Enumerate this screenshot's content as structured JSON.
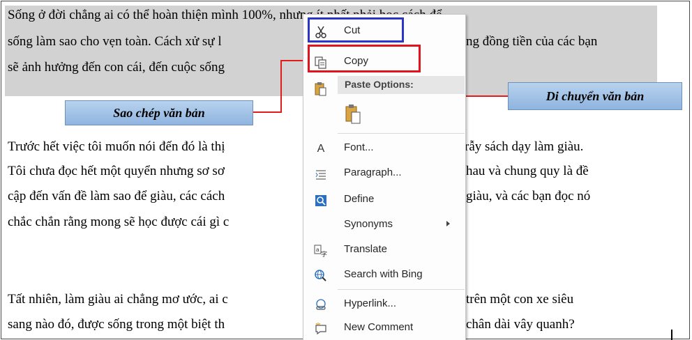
{
  "document": {
    "lines": [
      "Sống ở đời chẳng ai có thể hoàn thiện mình 100%, nhưng ít nhất phải học cách để",
      "sống làm sao cho vẹn toàn. Cách xử sự l",
      "ng đồng tiền của các bạn",
      "sẽ ảnh hưởng đến con cái, đến cuộc sống",
      "Trước hết việc tôi muốn nói đến đó là thị",
      "rẫy sách dạy làm giàu.",
      "Tôi chưa đọc hết một quyển nhưng sơ sơ",
      "hau và chung quy là đề",
      "cập đến vấn đề làm sao để giàu, các cách",
      "giàu, và các bạn đọc nó",
      "chắc chắn rằng mong sẽ học được cái gì c",
      "Tất nhiên, làm giàu ai chẳng mơ ước, ai c",
      "trên một con xe siêu",
      "sang nào đó, được sống trong một biệt th",
      "chân dài vây quanh?"
    ]
  },
  "callouts": {
    "copy": "Sao chép văn bản",
    "move": "Di chuyển văn bản"
  },
  "context_menu": {
    "cut": "Cut",
    "copy": "Copy",
    "paste_options": "Paste Options:",
    "font": "Font...",
    "paragraph": "Paragraph...",
    "define": "Define",
    "synonyms": "Synonyms",
    "translate": "Translate",
    "search_bing": "Search with Bing",
    "hyperlink": "Hyperlink...",
    "new_comment": "New Comment"
  },
  "icons": {
    "cut": "scissors-icon",
    "copy": "copy-icon",
    "paste": "clipboard-icon",
    "font": "font-icon",
    "paragraph": "paragraph-icon",
    "define": "define-book-icon",
    "translate": "translate-icon",
    "search": "search-globe-icon",
    "hyperlink": "link-icon",
    "comment": "comment-icon"
  },
  "colors": {
    "highlight_box_cut": "#2b36c8",
    "highlight_box_copy": "#e0141e",
    "callout_fill": "#9dbde4",
    "selection": "#d2d2d2"
  }
}
